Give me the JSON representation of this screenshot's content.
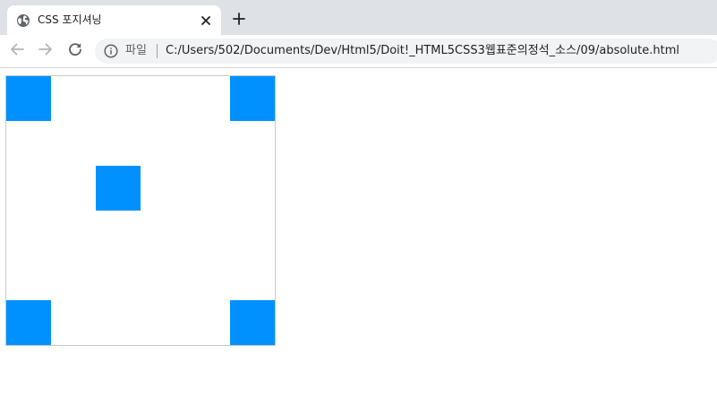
{
  "tab": {
    "title": "CSS 포지셔닝",
    "favicon_icon": "globe-icon",
    "close_icon": "close-icon"
  },
  "toolbar": {
    "new_tab_icon": "plus-icon",
    "back_icon": "arrow-left-icon",
    "forward_icon": "arrow-right-icon",
    "reload_icon": "reload-icon"
  },
  "omnibox": {
    "info_icon": "info-icon",
    "scheme_label": "파일",
    "url": "C:/Users/502/Documents/Dev/Html5/Doit!_HTML5CSS3웹표준의정석_소스/09/absolute.html"
  },
  "page": {
    "box_color": "#0091ff",
    "container_border_color": "#c8c8c8"
  }
}
